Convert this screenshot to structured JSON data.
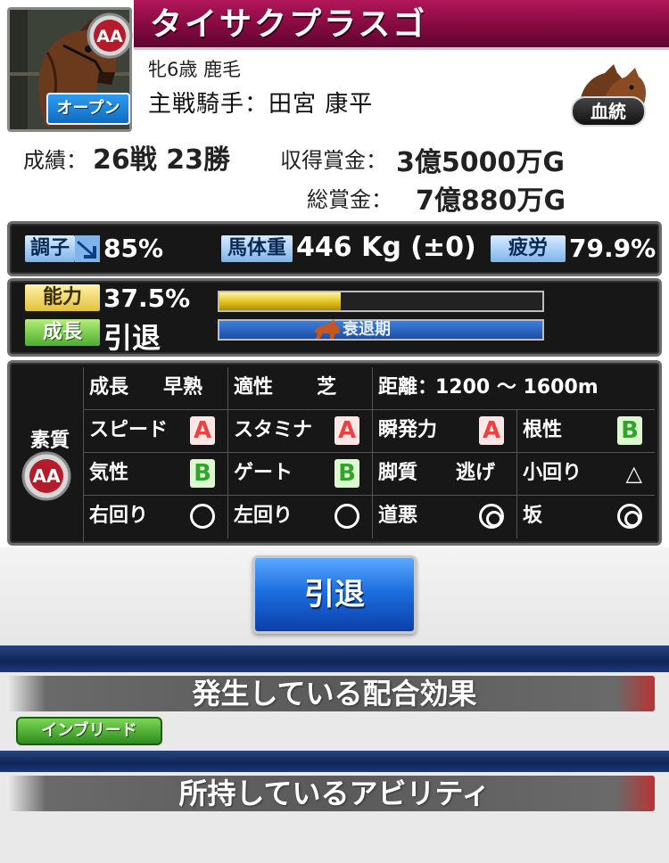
{
  "header": {
    "horse_name": "タイサクプラスゴ",
    "age_coat": "牝6歳 鹿毛",
    "jockey": "主戦騎手：田宮 康平",
    "rank_badge": "AA",
    "class_badge": "オープン",
    "bloodline_button": "血統"
  },
  "results": {
    "record_label": "成績：",
    "record_value": "26戦 23勝",
    "prize_label": "収得賞金：",
    "prize_value": "3億5000万G",
    "total_label": "総賞金：",
    "total_value": "7億880万G"
  },
  "condition": {
    "condition_label": "調子",
    "condition_value": "85%",
    "weight_label": "馬体重",
    "weight_value": "446 Kg (±0)",
    "fatigue_label": "疲労",
    "fatigue_value": "79.9%"
  },
  "ability": {
    "ability_label": "能力",
    "ability_value": "37.5%",
    "ability_fraction": 0.375,
    "growth_label": "成長",
    "growth_value": "引退",
    "growth_bar_text": "衰退期"
  },
  "aptitude": {
    "side_label": "素質",
    "side_badge": "AA",
    "row1": {
      "growth_label": "成長",
      "growth_value": "早熟",
      "surface_label": "適性",
      "surface_value": "芝",
      "distance_label": "距離：",
      "distance_value": "1200 〜 1600m"
    },
    "row2": {
      "speed_label": "スピード",
      "speed_grade": "A",
      "stamina_label": "スタミナ",
      "stamina_grade": "A",
      "burst_label": "瞬発力",
      "burst_grade": "A",
      "guts_label": "根性",
      "guts_grade": "B"
    },
    "row3": {
      "temper_label": "気性",
      "temper_grade": "B",
      "gate_label": "ゲート",
      "gate_grade": "B",
      "style_label": "脚質",
      "style_value": "逃げ",
      "tight_turn_label": "小回り",
      "tight_turn_mark": "△"
    },
    "row4": {
      "right_turn_label": "右回り",
      "right_turn_mark": "○",
      "left_turn_label": "左回り",
      "left_turn_mark": "○",
      "bad_track_label": "道悪",
      "bad_track_mark": "◎",
      "slope_label": "坂",
      "slope_mark": "◎"
    }
  },
  "actions": {
    "retire_button": "引退"
  },
  "sections": {
    "breeding_effects_title": "発生している配合効果",
    "breeding_effects": [
      "インブリード"
    ],
    "abilities_title": "所持しているアビリティ"
  },
  "colors": {
    "title_bar": "#8c0c44",
    "panel_bg": "#171717",
    "retire_button": "#1d6fe0",
    "grade_a": "#f24040",
    "grade_b": "#2fa52a"
  },
  "icons": [
    "horse-portrait",
    "aa-rank-badge",
    "bloodline-horse-icon",
    "trend-down-arrow-icon",
    "running-horse-icon"
  ]
}
